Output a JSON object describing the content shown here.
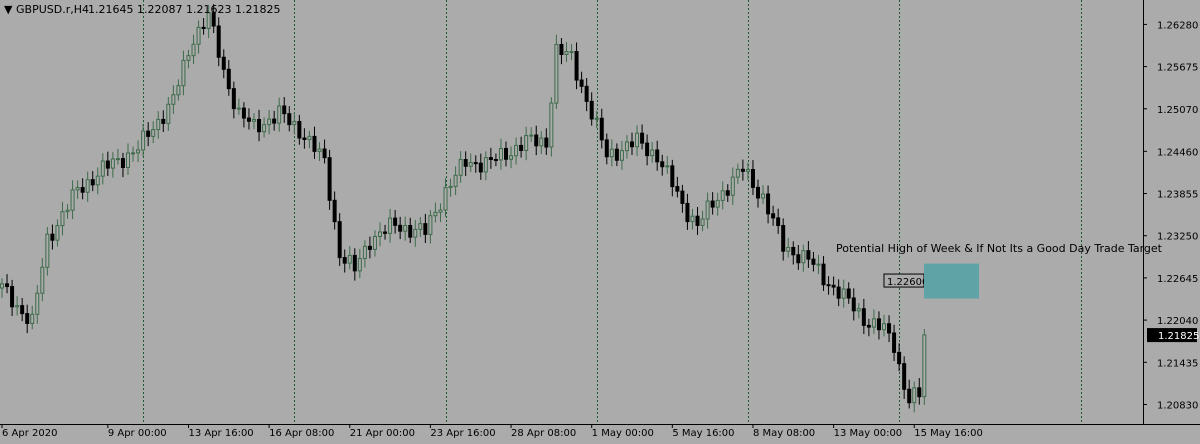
{
  "header": {
    "arrow": "▼",
    "symbol_label": "GBPUSD.r,H4",
    "ohlc": "1.21645 1.22087 1.21623 1.21825"
  },
  "colors": {
    "background": "#ababab",
    "bull_candle": "#3d6b4a",
    "bear_candle": "#000000",
    "separator": "#1d5a33",
    "box": "#5fa3a7",
    "price_tag_bg": "#000000",
    "price_tag_text": "#ffffff"
  },
  "annotation": {
    "text": "Potential High of Week & If Not Its a Good Day Trade Target",
    "level_label": "1.22600",
    "box_low": 1.2235,
    "box_high": 1.2285
  },
  "chart_data": {
    "type": "candlestick",
    "symbol": "GBPUSD.r",
    "timeframe": "H4",
    "ylim": [
      1.2055,
      1.2663
    ],
    "y_ticks": [
      "1.26280",
      "1.25675",
      "1.25070",
      "1.24460",
      "1.23855",
      "1.23250",
      "1.22645",
      "1.22040",
      "1.21435",
      "1.20830"
    ],
    "current_price": "1.21825",
    "x_labels": [
      {
        "label": "6 Apr 2020",
        "bar": 0
      },
      {
        "label": "9 Apr 00:00",
        "bar": 21
      },
      {
        "label": "13 Apr 16:00",
        "bar": 37
      },
      {
        "label": "16 Apr 08:00",
        "bar": 53
      },
      {
        "label": "21 Apr 00:00",
        "bar": 69
      },
      {
        "label": "23 Apr 16:00",
        "bar": 85
      },
      {
        "label": "28 Apr 08:00",
        "bar": 101
      },
      {
        "label": "1 May 00:00",
        "bar": 117
      },
      {
        "label": "5 May 16:00",
        "bar": 133
      },
      {
        "label": "8 May 08:00",
        "bar": 149
      },
      {
        "label": "13 May 00:00",
        "bar": 165
      },
      {
        "label": "15 May 16:00",
        "bar": 181
      }
    ],
    "week_separators_at_bar": [
      28,
      58,
      88,
      118,
      148,
      178,
      214
    ],
    "anchors": [
      [
        0,
        1.225
      ],
      [
        6,
        1.22
      ],
      [
        9,
        1.232
      ],
      [
        15,
        1.239
      ],
      [
        20,
        1.242
      ],
      [
        27,
        1.245
      ],
      [
        34,
        1.252
      ],
      [
        38,
        1.261
      ],
      [
        41,
        1.264
      ],
      [
        44,
        1.256
      ],
      [
        47,
        1.25
      ],
      [
        50,
        1.248
      ],
      [
        55,
        1.25
      ],
      [
        60,
        1.247
      ],
      [
        64,
        1.243
      ],
      [
        67,
        1.23
      ],
      [
        70,
        1.2275
      ],
      [
        73,
        1.232
      ],
      [
        78,
        1.234
      ],
      [
        84,
        1.233
      ],
      [
        88,
        1.239
      ],
      [
        92,
        1.243
      ],
      [
        97,
        1.243
      ],
      [
        104,
        1.246
      ],
      [
        108,
        1.246
      ],
      [
        110,
        1.259
      ],
      [
        113,
        1.258
      ],
      [
        117,
        1.25
      ],
      [
        120,
        1.244
      ],
      [
        126,
        1.246
      ],
      [
        130,
        1.244
      ],
      [
        135,
        1.237
      ],
      [
        138,
        1.234
      ],
      [
        142,
        1.238
      ],
      [
        147,
        1.242
      ],
      [
        151,
        1.238
      ],
      [
        155,
        1.231
      ],
      [
        160,
        1.229
      ],
      [
        165,
        1.225
      ],
      [
        168,
        1.223
      ],
      [
        172,
        1.22
      ],
      [
        175,
        1.219
      ],
      [
        177,
        1.217
      ],
      [
        179,
        1.211
      ],
      [
        180,
        1.209
      ],
      [
        182,
        1.2095
      ],
      [
        183,
        1.2182
      ]
    ]
  }
}
